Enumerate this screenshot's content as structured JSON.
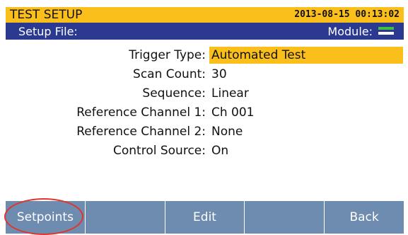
{
  "titlebar": {
    "title": "TEST SETUP",
    "datetime": "2013-08-15 00:13:02"
  },
  "subheader": {
    "setup_file_label": "Setup File:",
    "module_label": "Module:",
    "module_icon": "module-status-icon"
  },
  "fields": [
    {
      "label": "Trigger Type:",
      "value": "Automated Test",
      "selected": true
    },
    {
      "label": "Scan Count:",
      "value": "30",
      "selected": false
    },
    {
      "label": "Sequence:",
      "value": "Linear",
      "selected": false
    },
    {
      "label": "Reference Channel 1:",
      "value": "Ch 001",
      "selected": false
    },
    {
      "label": "Reference Channel 2:",
      "value": "None",
      "selected": false
    },
    {
      "label": "Control Source:",
      "value": "On",
      "selected": false
    }
  ],
  "softkeys": [
    "Setpoints",
    "",
    "Edit",
    "",
    "Back"
  ],
  "colors": {
    "accent": "#fbbf1c",
    "header": "#2b3990",
    "softkey_bg": "#6e8bb0",
    "highlight_ring": "#e0352b"
  }
}
